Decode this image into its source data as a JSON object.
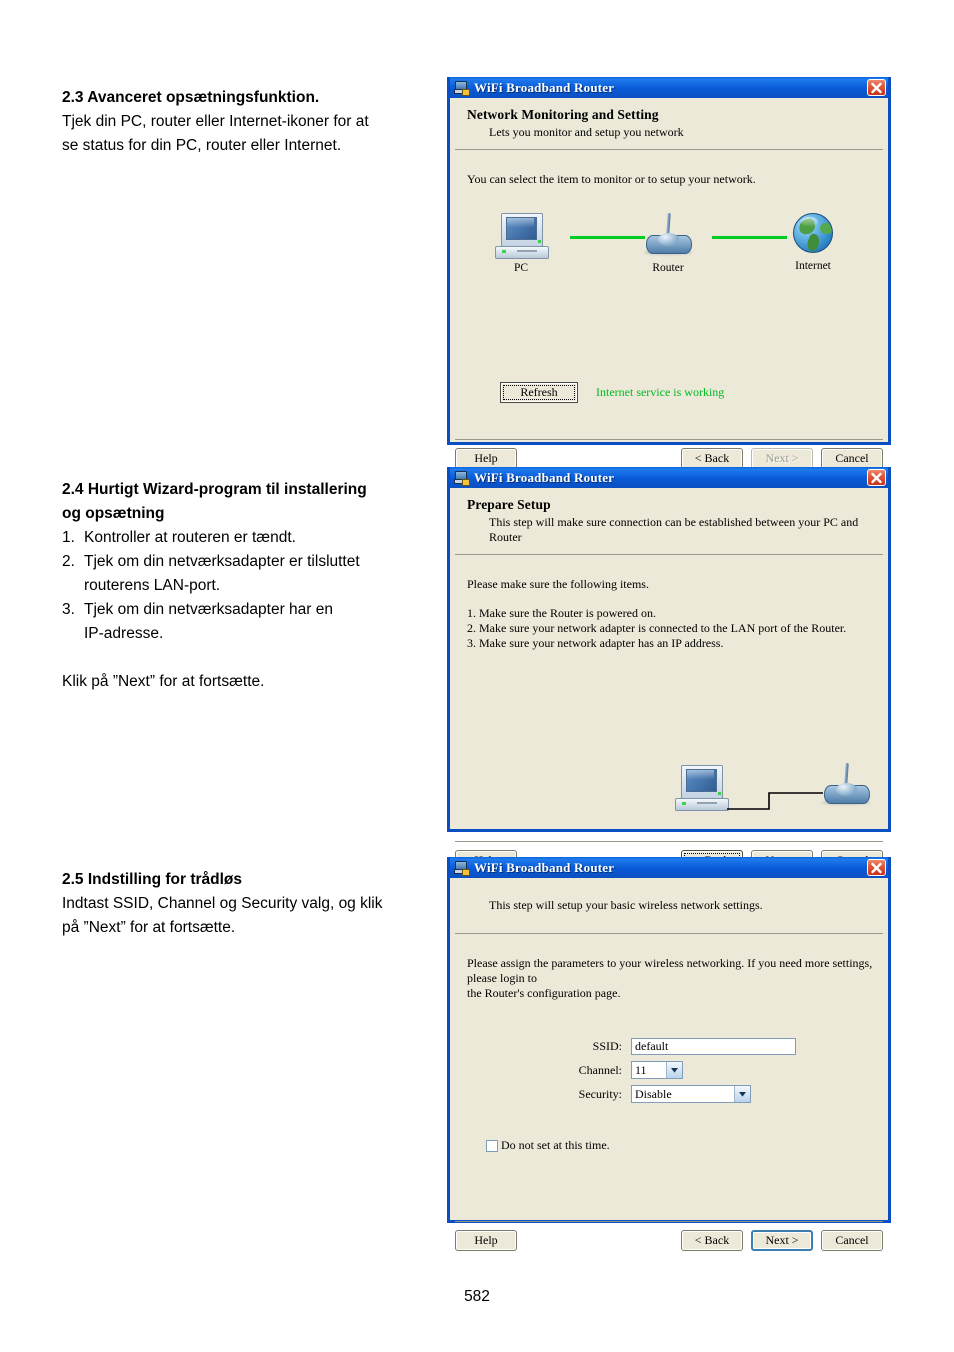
{
  "page": {
    "number": "582"
  },
  "sections": [
    {
      "heading": "2.3 Avanceret opsætningsfunktion.",
      "lines": [
        "Tjek din PC, router eller Internet-ikoner for at",
        "se status for din PC, router eller Internet."
      ]
    },
    {
      "heading_line1": "2.4 Hurtigt Wizard-program til installering",
      "heading_line2": "og opsætning",
      "items": [
        {
          "num": "1.",
          "text": "Kontroller at routeren er tændt."
        },
        {
          "num": "2.",
          "text": "Tjek om din netværksadapter er tilsluttet"
        },
        {
          "num": "",
          "text": "routerens LAN-port."
        },
        {
          "num": "3.",
          "text": "Tjek om din netværksadapter har en"
        },
        {
          "num": "",
          "text": "IP-adresse."
        }
      ],
      "closing": "Klik på ”Next” for at fortsætte."
    },
    {
      "heading": "2.5 Indstilling for trådløs",
      "lines": [
        "Indtast SSID, Channel og Security valg, og klik",
        "på ”Next” for at fortsætte."
      ]
    }
  ],
  "colors": {
    "titlebar": "#0A4FC1",
    "dialog_face": "#ECE9D8",
    "link_green": "#00CC22",
    "status_green": "#00BB22",
    "close_red": "#C8321B",
    "combo_border": "#7F9DB9"
  },
  "dialog1": {
    "title": "WiFi Broadband Router",
    "header_title": "Network Monitoring and Setting",
    "header_sub": "Lets you monitor and setup you network",
    "body_text": "You can select the item to monitor or to setup your network.",
    "nodes": [
      {
        "label": "PC",
        "icon": "computer-icon"
      },
      {
        "label": "Router",
        "icon": "router-icon"
      },
      {
        "label": "Internet",
        "icon": "globe-icon"
      }
    ],
    "refresh_label": "Refresh",
    "status_text": "Internet service is working",
    "buttons": {
      "help": "Help",
      "back": "< Back",
      "next": "Next >",
      "cancel": "Cancel"
    }
  },
  "dialog2": {
    "title": "WiFi Broadband Router",
    "header_title": "Prepare Setup",
    "header_sub": "This step will make sure connection can be established between your PC and Router",
    "body_intro": "Please make sure the following items.",
    "body_items": [
      "1. Make sure the Router is powered on.",
      "2. Make sure your network adapter is connected to the LAN port of the Router.",
      "3. Make sure your network adapter has an IP address."
    ],
    "buttons": {
      "help": "Help",
      "back": "< Back",
      "next": "Next >",
      "cancel": "Cancel"
    }
  },
  "dialog3": {
    "title": "WiFi Broadband Router",
    "header_sub": "This step will setup your basic wireless network settings.",
    "body_line1": "Please assign the parameters to your wireless networking. If you need more settings, please login to",
    "body_line2": "the Router's configuration page.",
    "fields": {
      "ssid_label": "SSID:",
      "ssid_value": "default",
      "channel_label": "Channel:",
      "channel_value": "11",
      "security_label": "Security:",
      "security_value": "Disable"
    },
    "checkbox_label": "Do not set at this time.",
    "buttons": {
      "help": "Help",
      "back": "< Back",
      "next": "Next >",
      "cancel": "Cancel"
    }
  }
}
